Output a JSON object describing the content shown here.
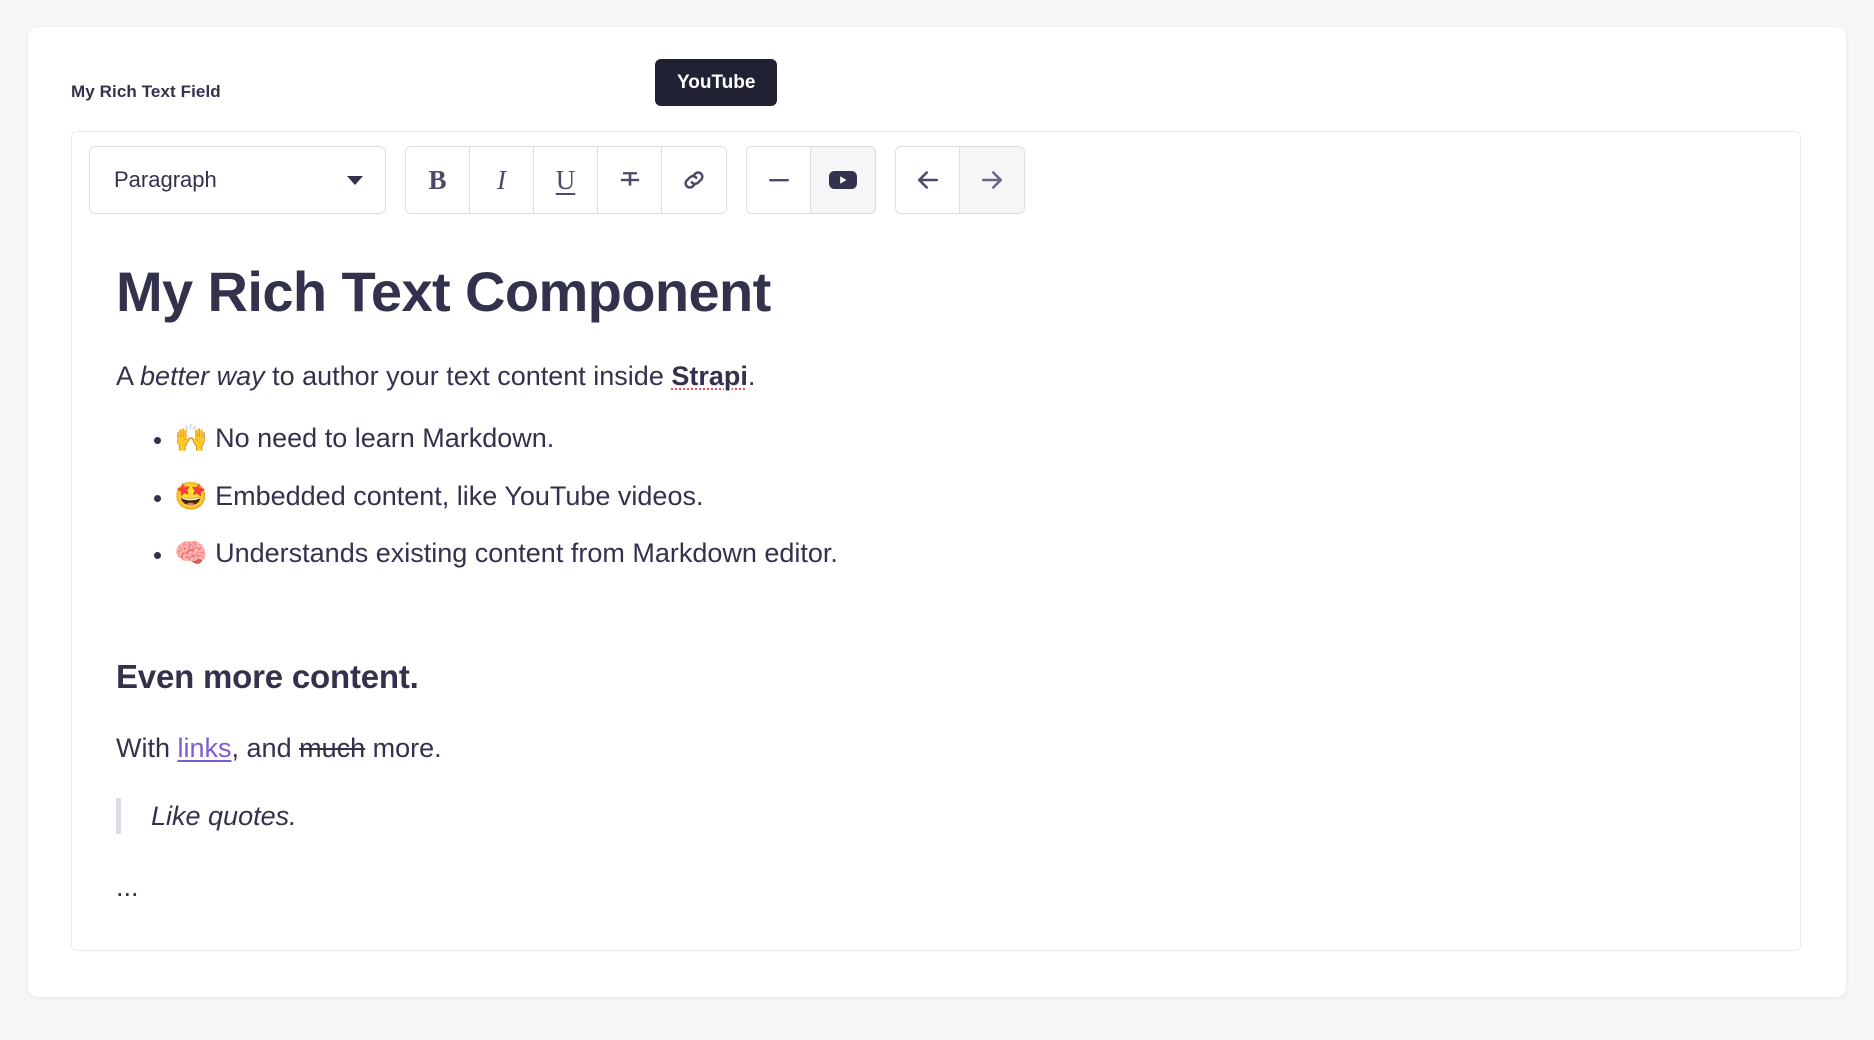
{
  "field": {
    "label": "My Rich Text Field"
  },
  "toolbar": {
    "block_select": {
      "value": "Paragraph",
      "caret_icon": "chevron-down-icon"
    },
    "format_buttons": [
      {
        "name": "bold",
        "glyph": "B",
        "label": "Bold",
        "active": false
      },
      {
        "name": "italic",
        "glyph": "I",
        "label": "Italic",
        "active": false
      },
      {
        "name": "underline",
        "glyph": "U",
        "label": "Underline",
        "active": false
      },
      {
        "name": "strikethrough",
        "glyph": "strikethrough-icon",
        "label": "Strikethrough",
        "active": false
      },
      {
        "name": "link",
        "glyph": "link-icon",
        "label": "Link",
        "active": false
      }
    ],
    "insert_buttons": [
      {
        "name": "horizontal-rule",
        "glyph": "horizontal-rule-icon",
        "label": "Horizontal rule",
        "active": false
      },
      {
        "name": "youtube",
        "glyph": "youtube-icon",
        "label": "YouTube",
        "active": true
      }
    ],
    "history_buttons": [
      {
        "name": "undo",
        "glyph": "arrow-left-icon",
        "label": "Undo",
        "disabled": false
      },
      {
        "name": "redo",
        "glyph": "arrow-right-icon",
        "label": "Redo",
        "disabled": true
      }
    ]
  },
  "tooltip": {
    "text": "YouTube",
    "background": "#212134",
    "color": "#ffffff"
  },
  "content": {
    "heading": "My Rich Text Component",
    "lead": {
      "before_italic": "A ",
      "italic": "better way",
      "after_italic": " to author your text content inside ",
      "bold_misspelled": "Strapi",
      "tail": "."
    },
    "bullets": [
      "🙌 No need to learn Markdown.",
      "🤩 Embedded content, like YouTube videos.",
      "🧠 Understands existing content from Markdown editor."
    ],
    "subheading": "Even more content.",
    "sub_paragraph": {
      "prefix": "With ",
      "link_text": "links",
      "middle": ", and ",
      "struck_text": "much",
      "suffix": " more."
    },
    "blockquote": "Like quotes.",
    "ellipsis": "..."
  },
  "colors": {
    "page_background": "#f6f6f9",
    "card_background": "#ffffff",
    "text": "#32324d",
    "border": "#eaeaef",
    "link": "#7b5cd6",
    "spellcheck_underline": "#f05252",
    "active_button": "#f0f0ff"
  }
}
